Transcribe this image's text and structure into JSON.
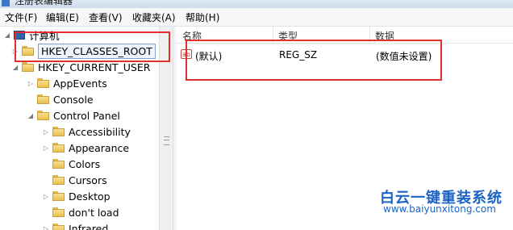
{
  "window": {
    "title": "注册表编辑器"
  },
  "menu": [
    "文件(F)",
    "编辑(E)",
    "查看(V)",
    "收藏夹(A)",
    "帮助(H)"
  ],
  "tree": {
    "root": "计算机",
    "hkcr": "HKEY_CLASSES_ROOT",
    "hkcu": "HKEY_CURRENT_USER",
    "appevents": "AppEvents",
    "console": "Console",
    "control_panel": "Control Panel",
    "cp_children": [
      "Accessibility",
      "Appearance",
      "Colors",
      "Cursors",
      "Desktop",
      "don't load",
      "Infrared"
    ]
  },
  "list": {
    "columns": [
      "名称",
      "类型",
      "数据"
    ],
    "rows": [
      {
        "icon": "string-value-icon",
        "icon_text": "ab",
        "name": "(默认)",
        "type": "REG_SZ",
        "data": "(数值未设置)"
      }
    ]
  },
  "watermark": {
    "brand": "白云一键重装系统",
    "url": "www.baiyunxitong.com"
  },
  "colors": {
    "highlight": "#e0312f",
    "watermark": "#1b63c6"
  }
}
